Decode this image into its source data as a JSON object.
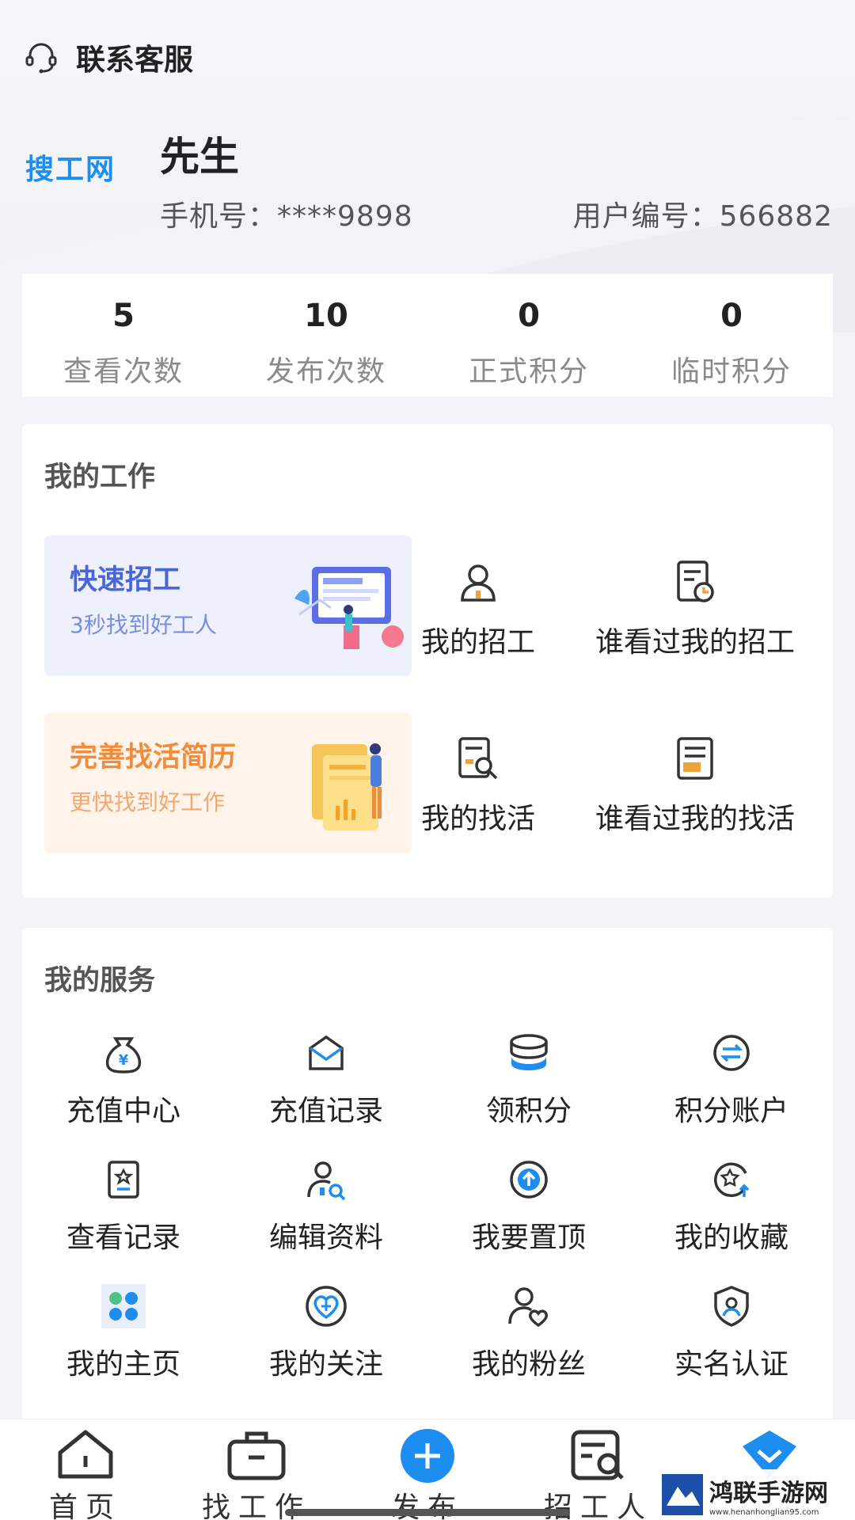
{
  "header": {
    "support_label": "联系客服",
    "logo_text": "搜工网",
    "user_name": "先生",
    "phone": "手机号：****9898",
    "user_id": "用户编号：566882"
  },
  "stats": [
    {
      "value": "5",
      "label": "查看次数"
    },
    {
      "value": "10",
      "label": "发布次数"
    },
    {
      "value": "0",
      "label": "正式积分"
    },
    {
      "value": "0",
      "label": "临时积分"
    }
  ],
  "work": {
    "title": "我的工作",
    "promo_hire": {
      "title": "快速招工",
      "subtitle": "3秒找到好工人"
    },
    "promo_resume": {
      "title": "完善找活简历",
      "subtitle": "更快找到好工作"
    },
    "items": [
      {
        "label": "我的招工",
        "icon": "person-icon"
      },
      {
        "label": "谁看过我的招工",
        "icon": "document-clock-icon"
      },
      {
        "label": "我的找活",
        "icon": "document-search-icon"
      },
      {
        "label": "谁看过我的找活",
        "icon": "document-list-icon"
      }
    ]
  },
  "services": {
    "title": "我的服务",
    "items": [
      {
        "label": "充值中心",
        "icon": "money-bag-icon"
      },
      {
        "label": "充值记录",
        "icon": "envelope-icon"
      },
      {
        "label": "领积分",
        "icon": "coin-stack-icon"
      },
      {
        "label": "积分账户",
        "icon": "exchange-icon"
      },
      {
        "label": "查看记录",
        "icon": "star-card-icon"
      },
      {
        "label": "编辑资料",
        "icon": "user-edit-icon"
      },
      {
        "label": "我要置顶",
        "icon": "arrow-up-circle-icon"
      },
      {
        "label": "我的收藏",
        "icon": "star-circle-icon"
      },
      {
        "label": "我的主页",
        "icon": "dots-grid-icon"
      },
      {
        "label": "我的关注",
        "icon": "heart-plus-icon"
      },
      {
        "label": "我的粉丝",
        "icon": "user-heart-icon"
      },
      {
        "label": "实名认证",
        "icon": "shield-user-icon"
      }
    ]
  },
  "tabbar": {
    "items": [
      {
        "label": "首页",
        "icon": "home-icon"
      },
      {
        "label": "找工作",
        "icon": "briefcase-icon"
      },
      {
        "label": "发布",
        "icon": "plus-circle-icon"
      },
      {
        "label": "招工人",
        "icon": "search-document-icon"
      },
      {
        "label": "",
        "icon": "chevron-down-icon"
      }
    ]
  },
  "watermark": {
    "title": "鸿联手游网",
    "url": "www.henanhonglian95.com"
  },
  "colors": {
    "brand_blue": "#1d8df0",
    "hire_accent": "#4a66d6",
    "resume_accent": "#f28b3c",
    "icon_orange": "#f0a23a"
  }
}
